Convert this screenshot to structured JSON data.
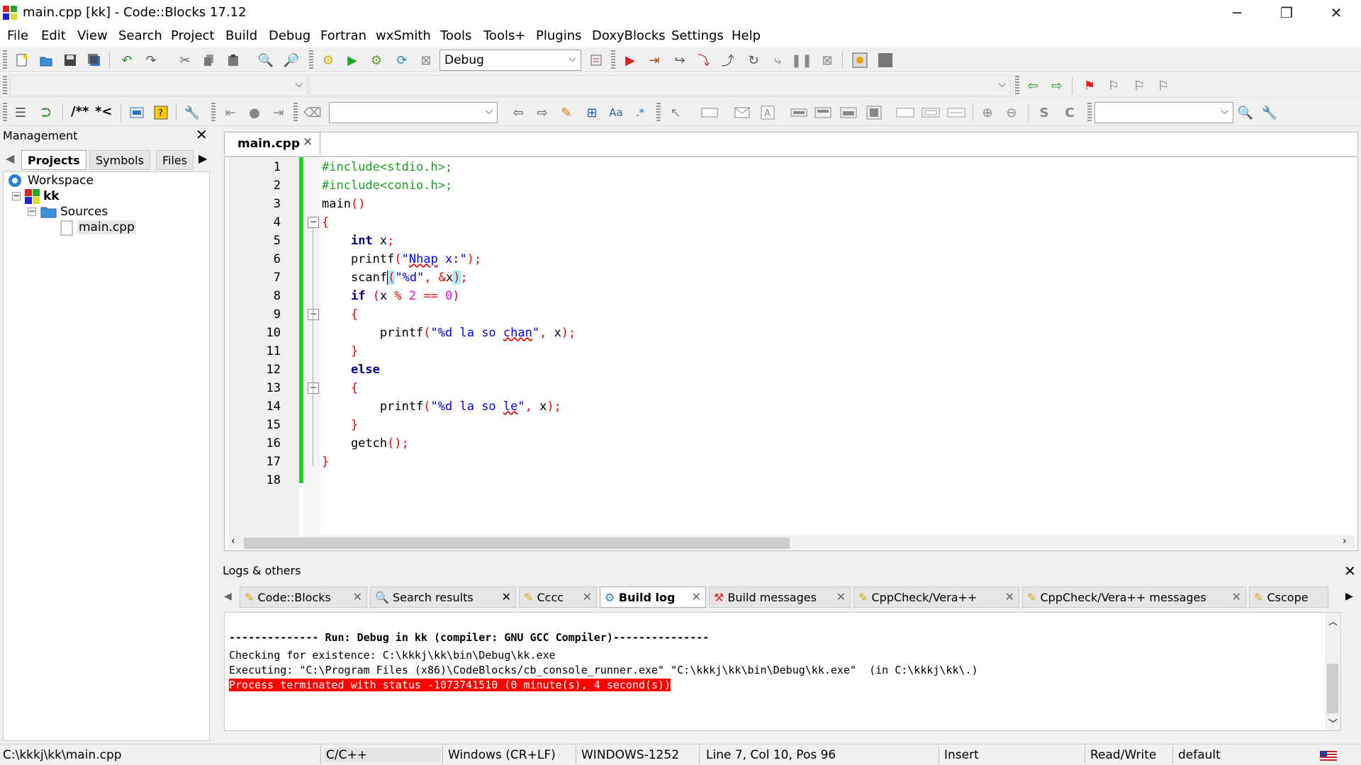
{
  "window": {
    "title": "main.cpp [kk] - Code::Blocks 17.12",
    "controls": [
      "─",
      "❐",
      "✕"
    ]
  },
  "menu": [
    "File",
    "Edit",
    "View",
    "Search",
    "Project",
    "Build",
    "Debug",
    "Fortran",
    "wxSmith",
    "Tools",
    "Tools+",
    "Plugins",
    "DoxyBlocks",
    "Settings",
    "Help"
  ],
  "toolbar": {
    "build_target": "Debug",
    "doxy_comment1": "/**",
    "doxy_comment2": "*<",
    "search_text": "",
    "find_text": ""
  },
  "management": {
    "title": "Management",
    "tabs": [
      "Projects",
      "Symbols",
      "Files"
    ],
    "tree": {
      "workspace": "Workspace",
      "project": "kk",
      "folder": "Sources",
      "file": "main.cpp"
    }
  },
  "editor": {
    "tab": "main.cpp",
    "line_numbers": [
      "1",
      "2",
      "3",
      "4",
      "5",
      "6",
      "7",
      "8",
      "9",
      "10",
      "11",
      "12",
      "13",
      "14",
      "15",
      "16",
      "17",
      "18"
    ]
  },
  "logs": {
    "title": "Logs & others",
    "tabs": [
      "Code::Blocks",
      "Search results",
      "Cccc",
      "Build log",
      "Build messages",
      "CppCheck/Vera++",
      "CppCheck/Vera++ messages",
      "Cscope"
    ],
    "active_tab": "Build log",
    "lines": [
      "-------------- Run: Debug in kk (compiler: GNU GCC Compiler)---------------",
      "Checking for existence: C:\\kkkj\\kk\\bin\\Debug\\kk.exe",
      "Executing: \"C:\\Program Files (x86)\\CodeBlocks/cb_console_runner.exe\" \"C:\\kkkj\\kk\\bin\\Debug\\kk.exe\"  (in C:\\kkkj\\kk\\.)",
      "Process terminated with status -1073741510 (0 minute(s), 4 second(s))"
    ],
    "error_color": "#ff0000"
  },
  "status": {
    "path": "C:\\kkkj\\kk\\main.cpp",
    "language": "C/C++",
    "eol": "Windows (CR+LF)",
    "encoding": "WINDOWS-1252",
    "position": "Line 7, Col 10, Pos 96",
    "mode": "Insert",
    "access": "Read/Write",
    "profile": "default"
  },
  "colors": {
    "change_bar": "#22cc22",
    "keyword": "#00008b",
    "preprocessor": "#22a022",
    "string": "#0000ff",
    "number": "#ff00ff",
    "operator": "#ff0000"
  }
}
